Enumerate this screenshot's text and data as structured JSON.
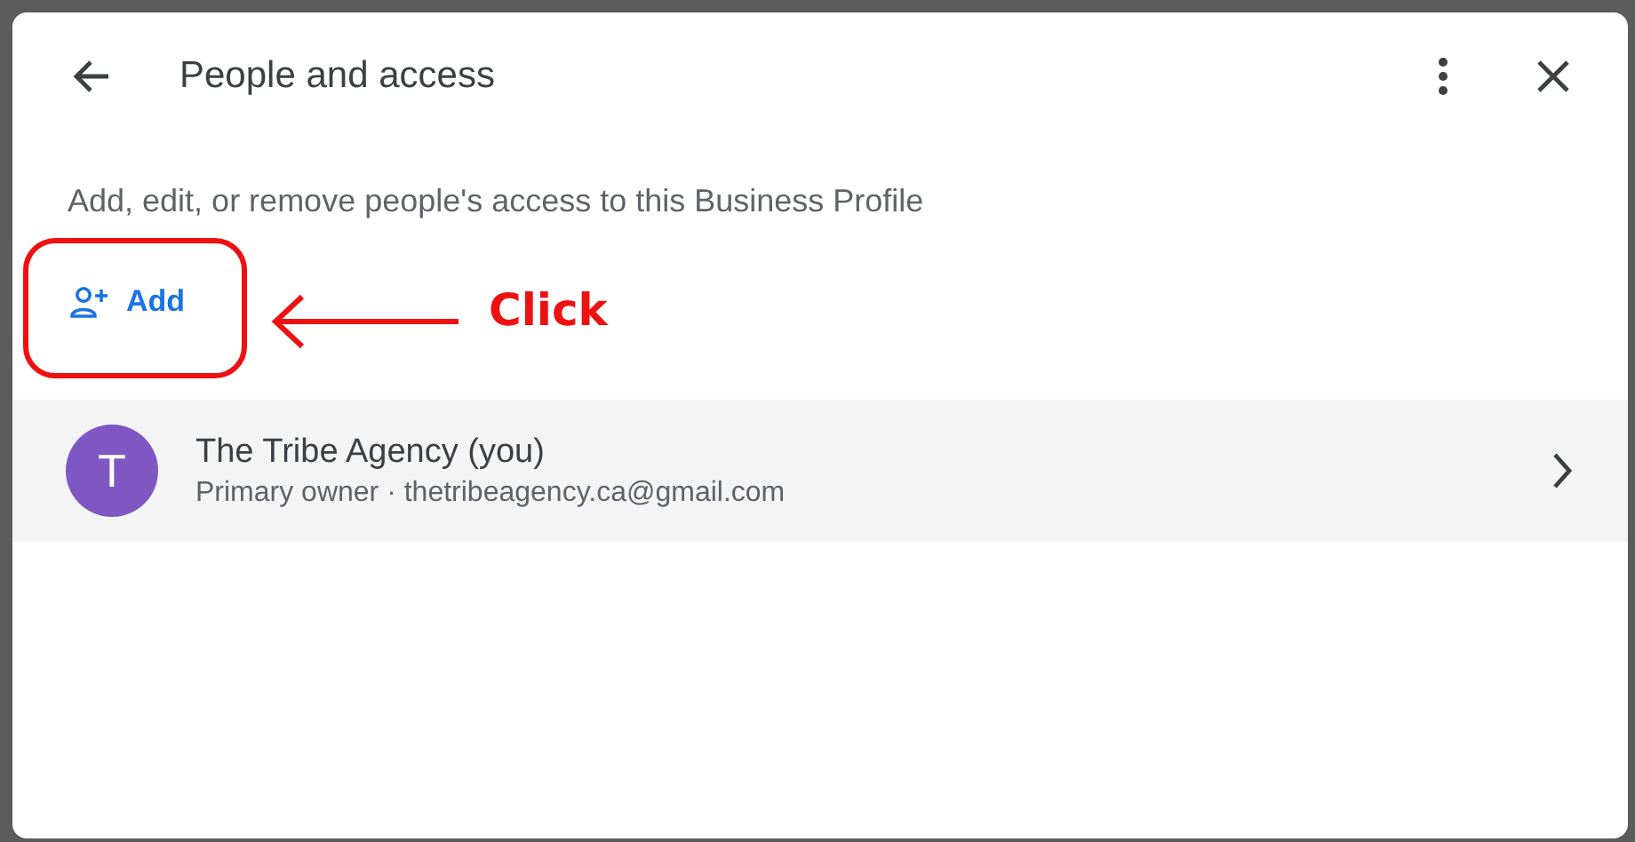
{
  "dialog": {
    "title": "People and access",
    "description": "Add, edit, or remove people's access to this Business Profile",
    "add_button": "Add"
  },
  "members": [
    {
      "avatar_letter": "T",
      "name": "The Tribe Agency (you)",
      "detail": "Primary owner · thetribeagency.ca@gmail.com"
    }
  ],
  "annotation": {
    "label": "Click"
  }
}
